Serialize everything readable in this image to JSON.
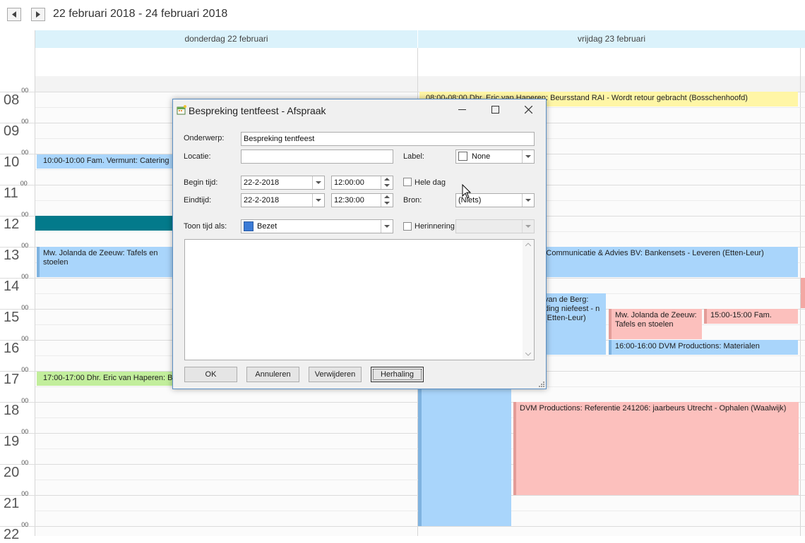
{
  "nav": {
    "date_range": "22 februari 2018 - 24 februari 2018"
  },
  "days": [
    {
      "label": "donderdag 22 februari"
    },
    {
      "label": "vrijdag 23 februari"
    }
  ],
  "hours": [
    "08",
    "09",
    "10",
    "11",
    "12",
    "13",
    "14",
    "15",
    "16",
    "17",
    "18",
    "19",
    "20",
    "21",
    "22"
  ],
  "minutes_label": "00",
  "appointments": {
    "a1": "08:00-08:00 Dhr. Eric van Haperen: Beursstand RAI - Wordt retour gebracht (Bosschenhoofd)",
    "a2": "10:00-10:00 Fam. Vermunt: Catering",
    "a3": "Mw. Jolanda de Zeeuw: Tafels en stoelen",
    "a4": "& Communicatie & Advies BV: Bankensets - Leveren (Etten-Leur)",
    "a5": "van de Berg: ding niefeest - n (Etten-Leur)",
    "a6": "Mw. Jolanda de Zeeuw: Tafels en stoelen",
    "a7": "15:00-15:00 Fam.",
    "a8": "16:00-16:00 DVM Productions: Materialen",
    "a9": "17:00-17:00 Dhr. Eric van Haperen: B",
    "a10": "DVM Productions: Referentie 241206: jaarbeurs Utrecht - Ophalen (Waalwijk)"
  },
  "colors": {
    "teal": "#037a8b",
    "day_header": "#dbf2fb"
  },
  "dialog": {
    "title": "Bespreking tentfeest - Afspraak",
    "onderwerp_label": "Onderwerp:",
    "onderwerp_value": "Bespreking tentfeest",
    "locatie_label": "Locatie:",
    "locatie_value": "",
    "label_label": "Label:",
    "label_value": "None",
    "begin_label": "Begin tijd:",
    "begin_date": "22-2-2018",
    "begin_time": "12:00:00",
    "hele_dag_label": "Hele dag",
    "eind_label": "Eindtijd:",
    "eind_date": "22-2-2018",
    "eind_time": "12:30:00",
    "bron_label": "Bron:",
    "bron_value": "(Niets)",
    "toon_label": "Toon tijd als:",
    "toon_value": "Bezet",
    "toon_color": "#3b7bd6",
    "herinnering_label": "Herinnering",
    "herinnering_value": "",
    "notes": "",
    "buttons": {
      "ok": "OK",
      "annuleren": "Annuleren",
      "verwijderen": "Verwijderen",
      "herhaling": "Herhaling"
    }
  }
}
